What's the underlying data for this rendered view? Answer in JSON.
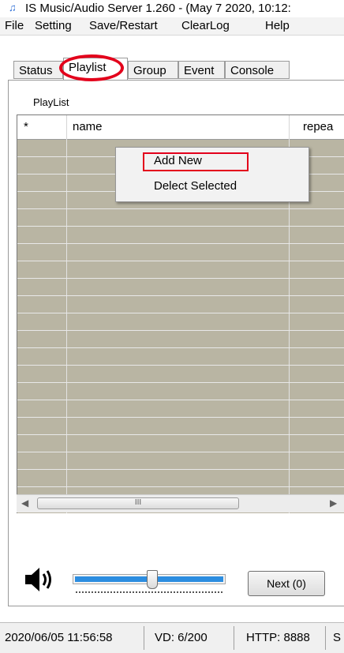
{
  "window": {
    "title": "IS Music/Audio Server 1.260 - (May  7 2020, 10:12:",
    "icon": "music-note-icon"
  },
  "menu": [
    "File",
    "Setting",
    "Save/Restart",
    "ClearLog",
    "Help"
  ],
  "tabs": [
    "Status",
    "Playlist",
    "Group",
    "Event",
    "Console"
  ],
  "active_tab": "Playlist",
  "playlist": {
    "group_label": "PlayList",
    "columns": [
      "*",
      "name",
      "repea"
    ],
    "rows": []
  },
  "context_menu": {
    "items": [
      "Add New",
      "Delect Selected"
    ]
  },
  "scrollbar": {
    "thumb_grip": "III"
  },
  "volume": {
    "icon": "speaker-icon",
    "level": 0.52
  },
  "buttons": {
    "next": "Next (0)"
  },
  "status_bar": {
    "datetime": "2020/06/05 11:56:58",
    "vd": "VD: 6/200",
    "http": "HTTP: 8888",
    "extra": "S"
  },
  "colors": {
    "annotation": "#e3001b",
    "grid_bg": "#b9b5a3",
    "slider_fill": "#2c8de0"
  }
}
